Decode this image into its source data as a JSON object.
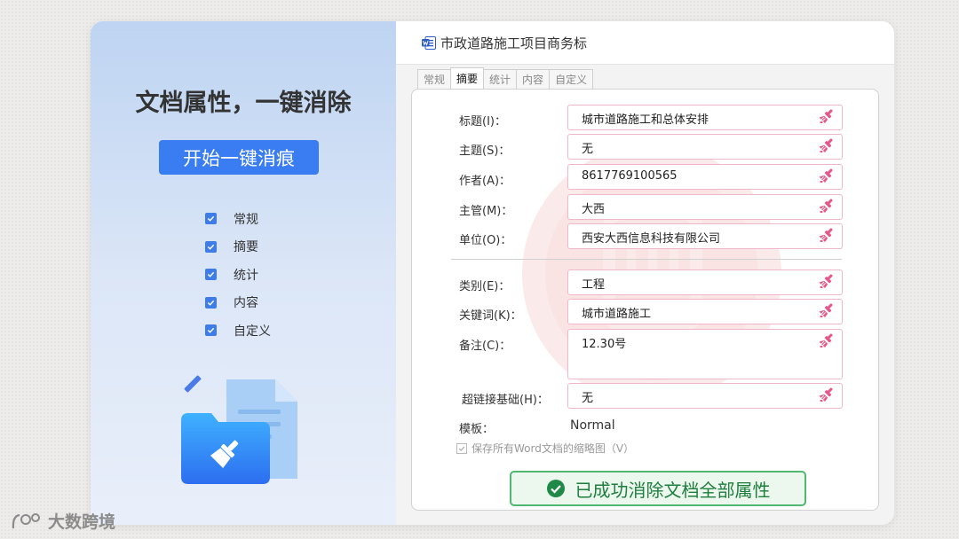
{
  "left": {
    "headline": "文档属性，一键消除",
    "start_button": "开始一键消痕",
    "options": [
      {
        "label": "常规",
        "checked": true
      },
      {
        "label": "摘要",
        "checked": true
      },
      {
        "label": "统计",
        "checked": true
      },
      {
        "label": "内容",
        "checked": true
      },
      {
        "label": "自定义",
        "checked": true
      }
    ]
  },
  "dialog": {
    "title": "市政道路施工项目商务标",
    "tabs": [
      "常规",
      "摘要",
      "统计",
      "内容",
      "自定义"
    ],
    "active_tab": "摘要",
    "fields": [
      {
        "label": "标题(I)：",
        "value": "城市道路施工和总体安排"
      },
      {
        "label": "主题(S)：",
        "value": "无"
      },
      {
        "label": "作者(A)：",
        "value": "8617769100565"
      },
      {
        "label": "主管(M)：",
        "value": "大西"
      },
      {
        "label": "单位(O)：",
        "value": "西安大西信息科技有限公司"
      },
      {
        "label": "类别(E)：",
        "value": "工程"
      },
      {
        "label": "关键词(K)：",
        "value": "城市道路施工"
      },
      {
        "label": "备注(C)：",
        "value": "12.30号"
      },
      {
        "label": "超链接基础(H)：",
        "value": "无"
      }
    ],
    "template_label": "模板：",
    "template_value": "Normal",
    "save_thumbnail_label": "保存所有Word文档的缩略图（V）",
    "success_message": "已成功消除文档全部属性"
  },
  "brand": "大数跨境",
  "colors": {
    "accent": "#3a7cf2",
    "field_border": "#f0b7cc",
    "broom": "#e8578a",
    "success": "#4fb772"
  },
  "icons": [
    "word-icon",
    "broom-icon",
    "checkmark-icon",
    "folder-icon",
    "document-icon",
    "pen-icon"
  ]
}
